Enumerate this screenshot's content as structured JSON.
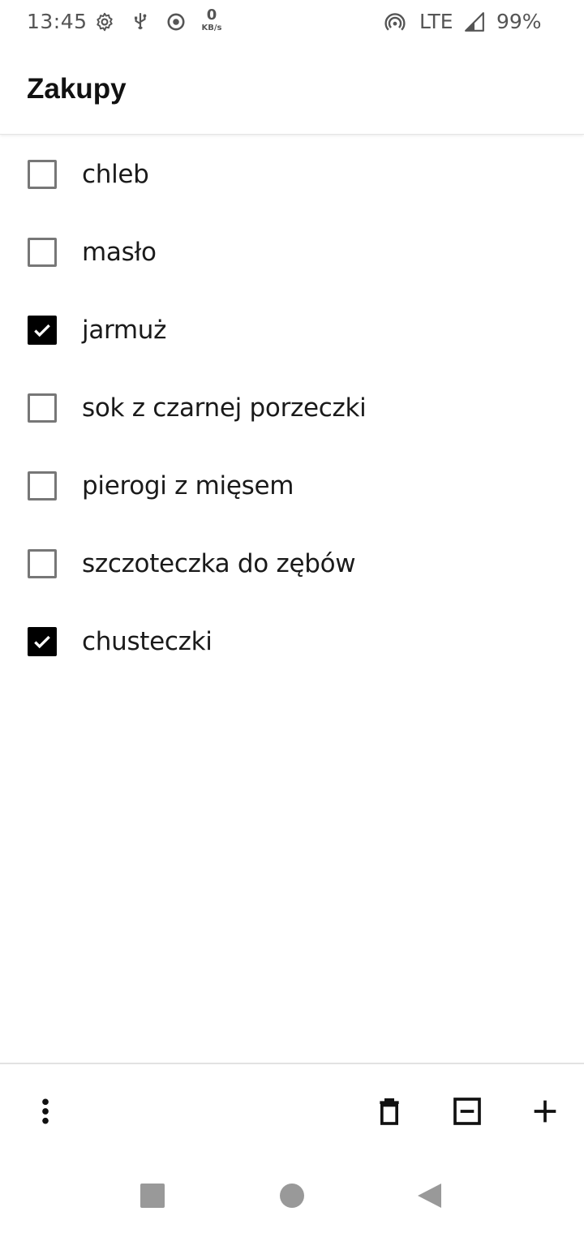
{
  "status_bar": {
    "time": "13:45",
    "netspeed_value": "0",
    "netspeed_unit": "KB/s",
    "network": "LTE",
    "battery": "99%",
    "icons": [
      "settings-icon",
      "usb-icon",
      "record-icon",
      "hotspot-icon",
      "signal-icon"
    ]
  },
  "app_bar": {
    "title": "Zakupy"
  },
  "items": [
    {
      "label": "chleb",
      "checked": false
    },
    {
      "label": "masło",
      "checked": false
    },
    {
      "label": "jarmuż",
      "checked": true
    },
    {
      "label": "sok z czarnej porzeczki",
      "checked": false
    },
    {
      "label": "pierogi z mięsem",
      "checked": false
    },
    {
      "label": "szczoteczka do zębów",
      "checked": false
    },
    {
      "label": "chusteczki",
      "checked": true
    }
  ],
  "bottom_bar": {
    "icons": [
      "more-vert-icon",
      "delete-icon",
      "remove-checked-icon",
      "add-icon"
    ]
  },
  "nav_bar": {
    "icons": [
      "recents-icon",
      "home-icon",
      "back-icon"
    ]
  }
}
